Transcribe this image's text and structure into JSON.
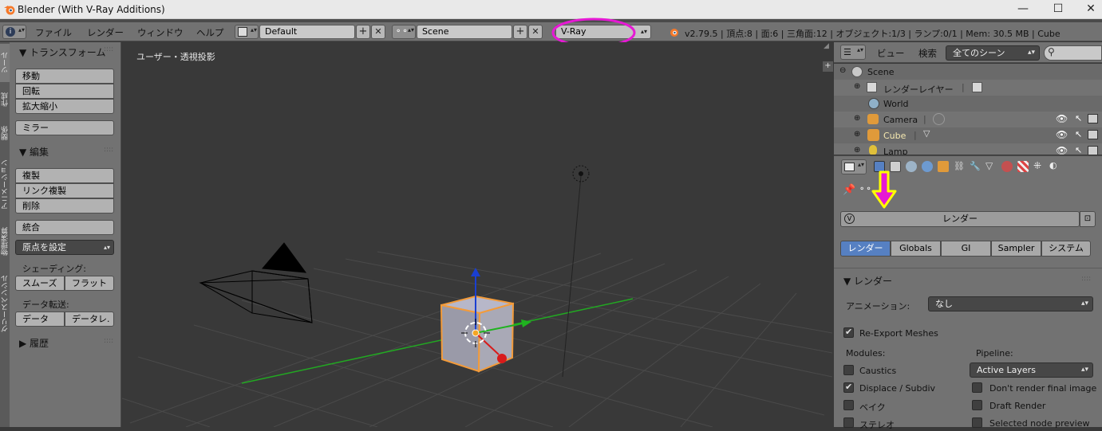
{
  "window": {
    "title": "Blender (With V-Ray Additions)",
    "minimize": "—",
    "maximize": "☐",
    "close": "✕"
  },
  "menu": {
    "items": [
      "ファイル",
      "レンダー",
      "ウィンドウ",
      "ヘルプ"
    ]
  },
  "header": {
    "layout": "Default",
    "scene": "Scene",
    "engine": "V-Ray",
    "stats": "v2.79.5 | 頂点:8 | 面:6 | 三角面:12 | オブジェクト:1/3 | ランプ:0/1 | Mem: 30.5 MB | Cube",
    "plus": "+",
    "x": "✕"
  },
  "tabs": [
    "ツール",
    "作成",
    "関係",
    "アニメーション",
    "物理演算",
    "グリースペンシル"
  ],
  "toolshelf": {
    "transform_title": "▼ トランスフォーム",
    "transform": [
      "移動",
      "回転",
      "拡大縮小"
    ],
    "mirror": "ミラー",
    "edit_title": "▼ 編集",
    "edit": [
      "複製",
      "リンク複製",
      "削除"
    ],
    "join": "統合",
    "origin": "原点を設定",
    "shading_label": "シェーディング:",
    "smooth": "スムーズ",
    "flat": "フラット",
    "data_label": "データ転送:",
    "data": "データ",
    "data2": "データレ.",
    "history": "▶ 履歴",
    "dots": "::::"
  },
  "viewport": {
    "label": "ユーザー・透視投影"
  },
  "outliner": {
    "view": "ビュー",
    "search": "検索",
    "scenes": "全てのシーン",
    "rows": [
      "Scene",
      "レンダーレイヤー",
      "World",
      "Camera",
      "Cube",
      "Lamp"
    ]
  },
  "properties": {
    "context_title": "レンダー",
    "tabs": [
      "レンダー",
      "Globals",
      "GI",
      "Sampler",
      "システム"
    ],
    "panel_title": "▼ レンダー",
    "animation_label": "アニメーション:",
    "animation_value": "なし",
    "reexport": "Re-Export Meshes",
    "modules_label": "Modules:",
    "pipeline_label": "Pipeline:",
    "pipeline_value": "Active Layers",
    "modules": [
      "Caustics",
      "Displace / Subdiv",
      "ベイク",
      "ステレオ"
    ],
    "modules_checked": [
      false,
      true,
      false,
      false
    ],
    "pipeline_opts": [
      "Don't render final image",
      "Draft Render",
      "Selected node preview"
    ],
    "colors": {
      "annotation_circle": "#e619d4",
      "annotation_arrow": "#ffff00",
      "arrow_fill": "#e619d4",
      "active_tab": "#5680c2"
    }
  }
}
